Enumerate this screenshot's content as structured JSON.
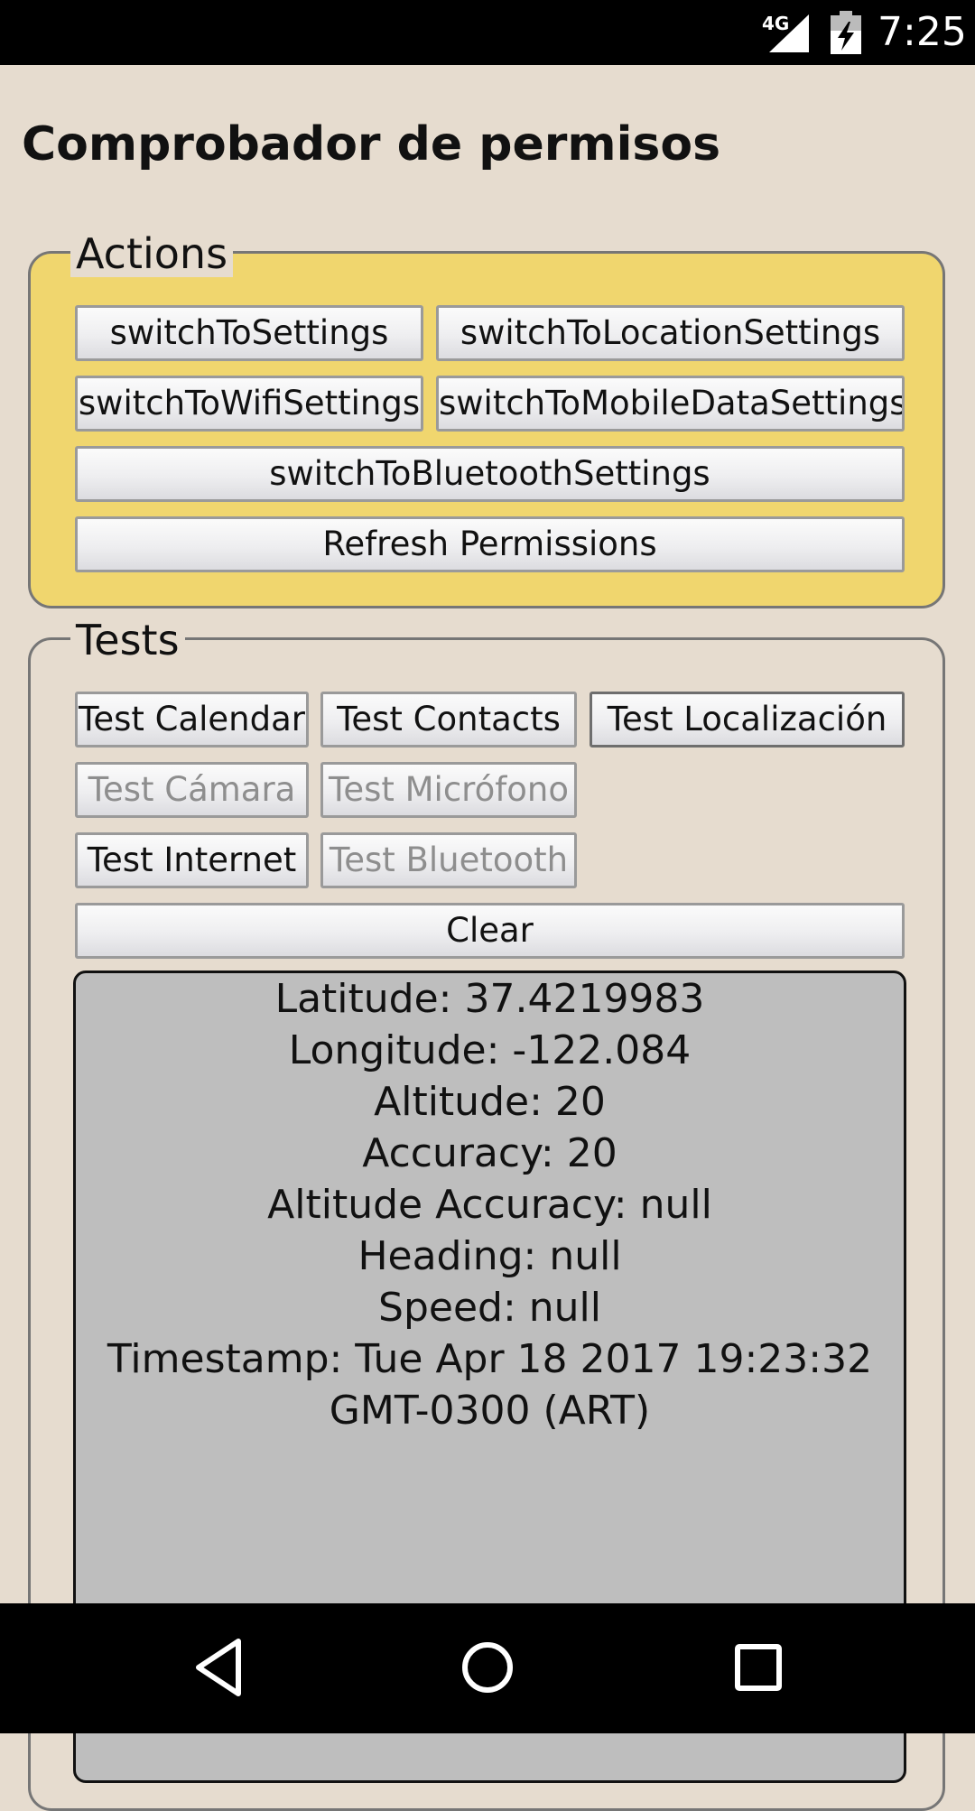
{
  "status_bar": {
    "network": "4G",
    "time": "7:25",
    "icons": [
      "signal-icon",
      "battery-charging-icon"
    ]
  },
  "title": "Comprobador de permisos",
  "actions": {
    "legend": "Actions",
    "buttons": {
      "switch_settings": "switchToSettings",
      "switch_location": "switchToLocationSettings",
      "switch_wifi": "switchToWifiSettings",
      "switch_mobile": "switchToMobileDataSettings",
      "switch_bluetooth": "switchToBluetoothSettings",
      "refresh": "Refresh Permissions"
    }
  },
  "tests": {
    "legend": "Tests",
    "buttons": {
      "calendar": "Test Calendar",
      "contacts": "Test Contacts",
      "location": "Test Localización",
      "camera": "Test Cámara",
      "microphone": "Test Micrófono",
      "internet": "Test Internet",
      "bluetooth": "Test Bluetooth",
      "clear": "Clear"
    },
    "output": {
      "latitude": "Latitude: 37.4219983",
      "longitude": "Longitude: -122.084",
      "altitude": "Altitude: 20",
      "accuracy": "Accuracy: 20",
      "altitude_accuracy": "Altitude Accuracy: null",
      "heading": "Heading: null",
      "speed": "Speed: null",
      "timestamp_1": "Timestamp: Tue Apr 18 2017 19:23:32",
      "timestamp_2": "GMT-0300 (ART)"
    }
  },
  "nav_bar": {
    "icons": [
      "back-icon",
      "home-icon",
      "recents-icon"
    ]
  }
}
